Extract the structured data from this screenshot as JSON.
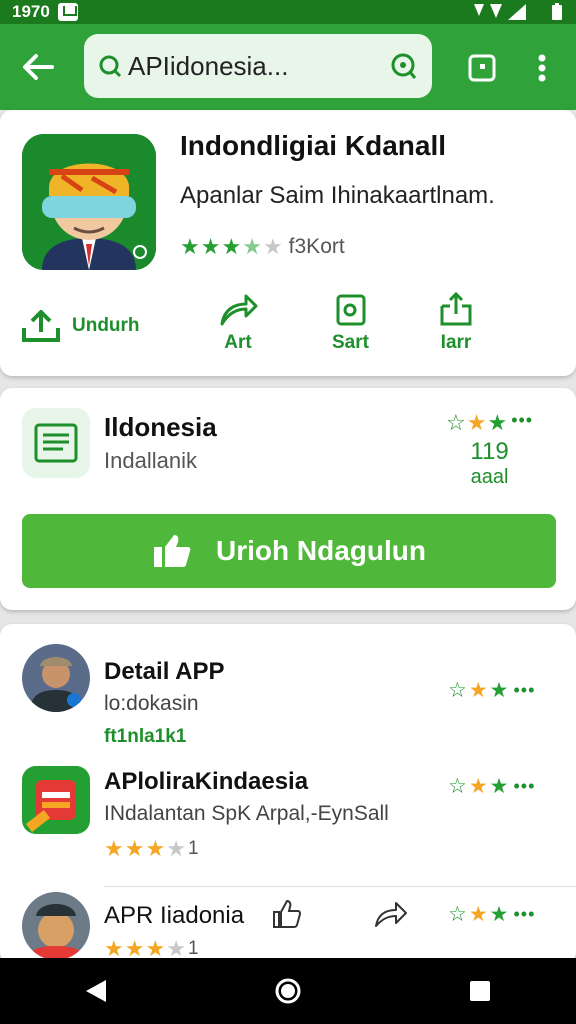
{
  "status_bar": {
    "time": "1970"
  },
  "toolbar": {
    "search_text": "APIidonesia..."
  },
  "app": {
    "title": "Indondligiai Kdanall",
    "subtitle": "Apanlar Saim Ihinakaartlnam.",
    "rating_text": "f3Kort",
    "stars": 3.5,
    "actions": [
      {
        "label": "Undurh"
      },
      {
        "label": "Art"
      },
      {
        "label": "Sart"
      },
      {
        "label": "Iarr"
      }
    ]
  },
  "feature": {
    "title": "Ildonesia",
    "subtitle": "Indallanik",
    "count": "119",
    "unit": "aaal",
    "button_label": "Urioh Ndagulun"
  },
  "list": [
    {
      "title": "Detail APP",
      "subtitle": "lo:dokasin",
      "meta": "ft1nla1k1"
    },
    {
      "title": "APloliraKindaesia",
      "subtitle": "INdalantan SpK Arpal,-EynSall",
      "rating_count": "1",
      "stars": 3.5
    },
    {
      "title": "APR Iiadonia",
      "rating_count": "1",
      "stars": 3.5
    }
  ],
  "colors": {
    "primary": "#2fa33a",
    "status_bar": "#1b7a1e",
    "accent": "#4fb83a",
    "star_gold": "#f5a623"
  }
}
